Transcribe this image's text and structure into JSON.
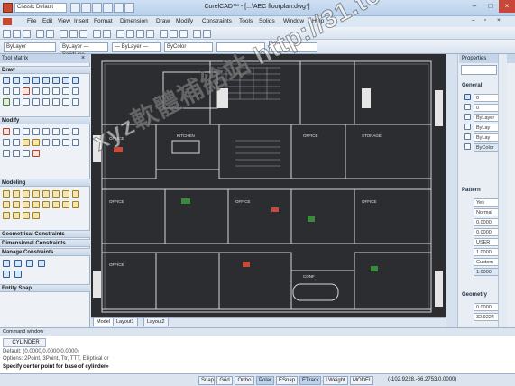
{
  "titlebar": {
    "workspace": "Classic Default",
    "title": "CorelCAD™ - [...\\AEC floorplan.dwg*]"
  },
  "menu": [
    "File",
    "Edit",
    "View",
    "Insert",
    "Format",
    "Dimension",
    "Draw",
    "Modify",
    "Constraints",
    "Tools",
    "Solids",
    "Window",
    "Help"
  ],
  "toolbar2": {
    "layer": "ByLayer",
    "linetype": "ByLayer — SolidLine",
    "lineweight": "— ByLayer —",
    "color": "ByColor"
  },
  "toolmatrix": {
    "title": "Tool Matrix",
    "sections": [
      "Draw",
      "Modify",
      "Modeling",
      "Geometrical Constraints",
      "Dimensional Constraints",
      "Manage Constraints",
      "Entity Snap"
    ]
  },
  "drawing": {
    "room_labels": [
      "OFFICE",
      "KITCHEN",
      "OFFICE",
      "OFFICE",
      "CONF",
      "STORAGE",
      "OFFICE",
      "OFFICE",
      "OFFICE"
    ]
  },
  "layout_tabs": [
    "Model",
    "Layout1",
    "Layout2"
  ],
  "properties": {
    "title": "Properties",
    "general_label": "General",
    "pattern_label": "Pattern",
    "geometry_label": "Geometry",
    "general": [
      "0",
      "0",
      "ByLayer",
      "ByLay",
      "ByLay",
      "ByColor"
    ],
    "pattern": [
      "Yes",
      "Normal",
      "0.0000",
      "0.0000",
      "USER",
      "1.0000",
      "Custom",
      "1.0000"
    ],
    "geometry": [
      "0.0000",
      "32.9224"
    ]
  },
  "command": {
    "title": "Command window",
    "input": "_CYLINDER",
    "lines": [
      "Default: (0.0000,0.0000,0.0000)",
      "Options: 2Point, 3Point, Ttr, TTT, Elliptical or",
      "Specify center point for base of cylinder»"
    ]
  },
  "status": {
    "buttons": [
      "Snap",
      "Grid",
      "Ortho",
      "Polar",
      "ESnap",
      "ETrack",
      "LWeight",
      "MODEL"
    ],
    "coords": "(-102.9228,-66.2753,0.0000)"
  },
  "watermark": "xyz軟體補給站 http://31.to"
}
